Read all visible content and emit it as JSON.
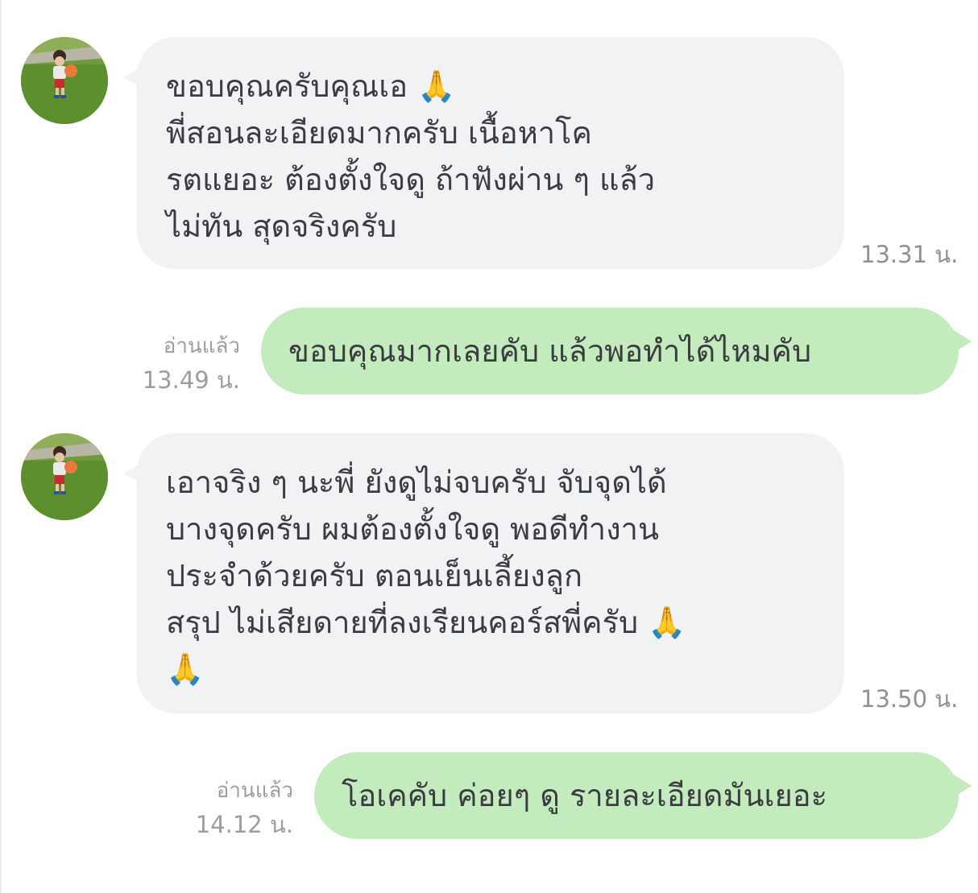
{
  "messages": [
    {
      "direction": "incoming",
      "avatar_icon": "child-photo-avatar",
      "lines": [
        "ขอบคุณครับคุณเอ 🙏",
        "พี่สอนละเอียดมากครับ เนื้อหาโค",
        "รตแยอะ ต้องตั้งใจดู ถ้าฟังผ่าน ๆ แล้ว",
        "ไม่ทัน สุดจริงครับ"
      ],
      "time": "13.31 น."
    },
    {
      "direction": "outgoing",
      "read_label": "อ่านแล้ว",
      "time": "13.49 น.",
      "text": "ขอบคุณมากเลยคับ แล้วพอทำได้ไหมคับ"
    },
    {
      "direction": "incoming",
      "avatar_icon": "child-photo-avatar",
      "lines": [
        "เอาจริง ๆ นะพี่ ยังดูไม่จบครับ  จับจุดได้",
        "บางจุดครับ ผมต้องตั้งใจดู พอดีทำงาน",
        "ประจำด้วยครับ ตอนเย็นเลี้ยงลูก",
        "สรุป ไม่เสียดายที่ลงเรียนคอร์สพี่ครับ 🙏",
        "🙏"
      ],
      "time": "13.50 น."
    },
    {
      "direction": "outgoing",
      "read_label": "อ่านแล้ว",
      "time": "14.12 น.",
      "text": "โอเคคับ ค่อยๆ ดู รายละเอียดมันเยอะ"
    }
  ],
  "colors": {
    "incoming_bubble": "#f1f2f4",
    "outgoing_bubble": "#c4ebbd",
    "text": "#3a3d40",
    "meta_text": "#9a9ea2"
  }
}
